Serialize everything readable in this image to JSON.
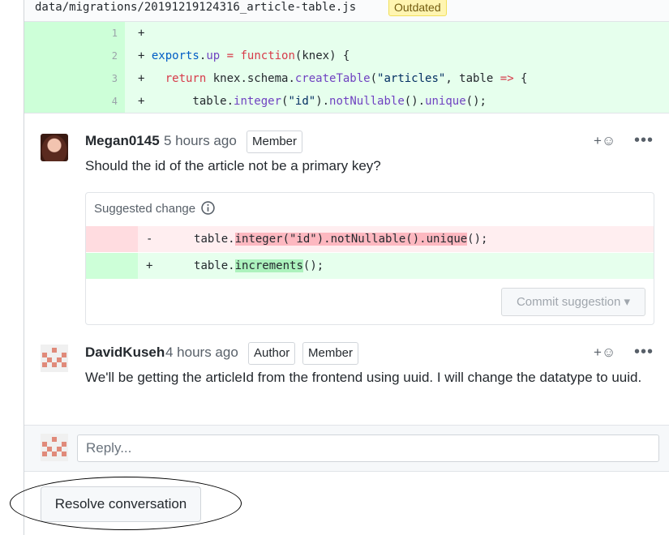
{
  "file": {
    "path": "data/migrations/20191219124316_article-table.js",
    "badge": "Outdated"
  },
  "diff_lines": [
    {
      "number": "1",
      "code": "+"
    },
    {
      "number": "2",
      "code": "+ exports.up = function(knex) {"
    },
    {
      "number": "3",
      "code": "+   return knex.schema.createTable(\"articles\", table => {"
    },
    {
      "number": "4",
      "code": "+       table.integer(\"id\").notNullable().unique();"
    }
  ],
  "comments": [
    {
      "author": "Megan0145",
      "time": "5 hours ago",
      "badges": [
        "Member"
      ],
      "body": "Should the id of the article not be a primary key?",
      "reaction": "+☺",
      "menu": "•••"
    },
    {
      "author": "DavidKuseh",
      "time": "4 hours ago",
      "badges": [
        "Author",
        "Member"
      ],
      "body": "We'll be getting the articleId from the frontend using uuid. I will change the datatype to uuid.",
      "reaction": "+☺",
      "menu": "•••"
    }
  ],
  "suggestion": {
    "title": "Suggested change",
    "info_icon": "info-icon",
    "removed": {
      "sign": "-",
      "prefix": "      table.",
      "highlight": "integer(\"id\").notNullable().unique",
      "suffix": "();"
    },
    "added": {
      "sign": "+",
      "prefix": "      table.",
      "highlight": "increments",
      "suffix": "();"
    },
    "commit_label": "Commit suggestion ▾"
  },
  "reply": {
    "placeholder": "Reply..."
  },
  "resolve_label": "Resolve conversation",
  "colors": {
    "added_bg": "#e6ffed",
    "removed_bg": "#ffeef0",
    "badge_yellow": "#fff5b1",
    "keyword_red": "#d73a49",
    "function_purple": "#6f42c1"
  }
}
